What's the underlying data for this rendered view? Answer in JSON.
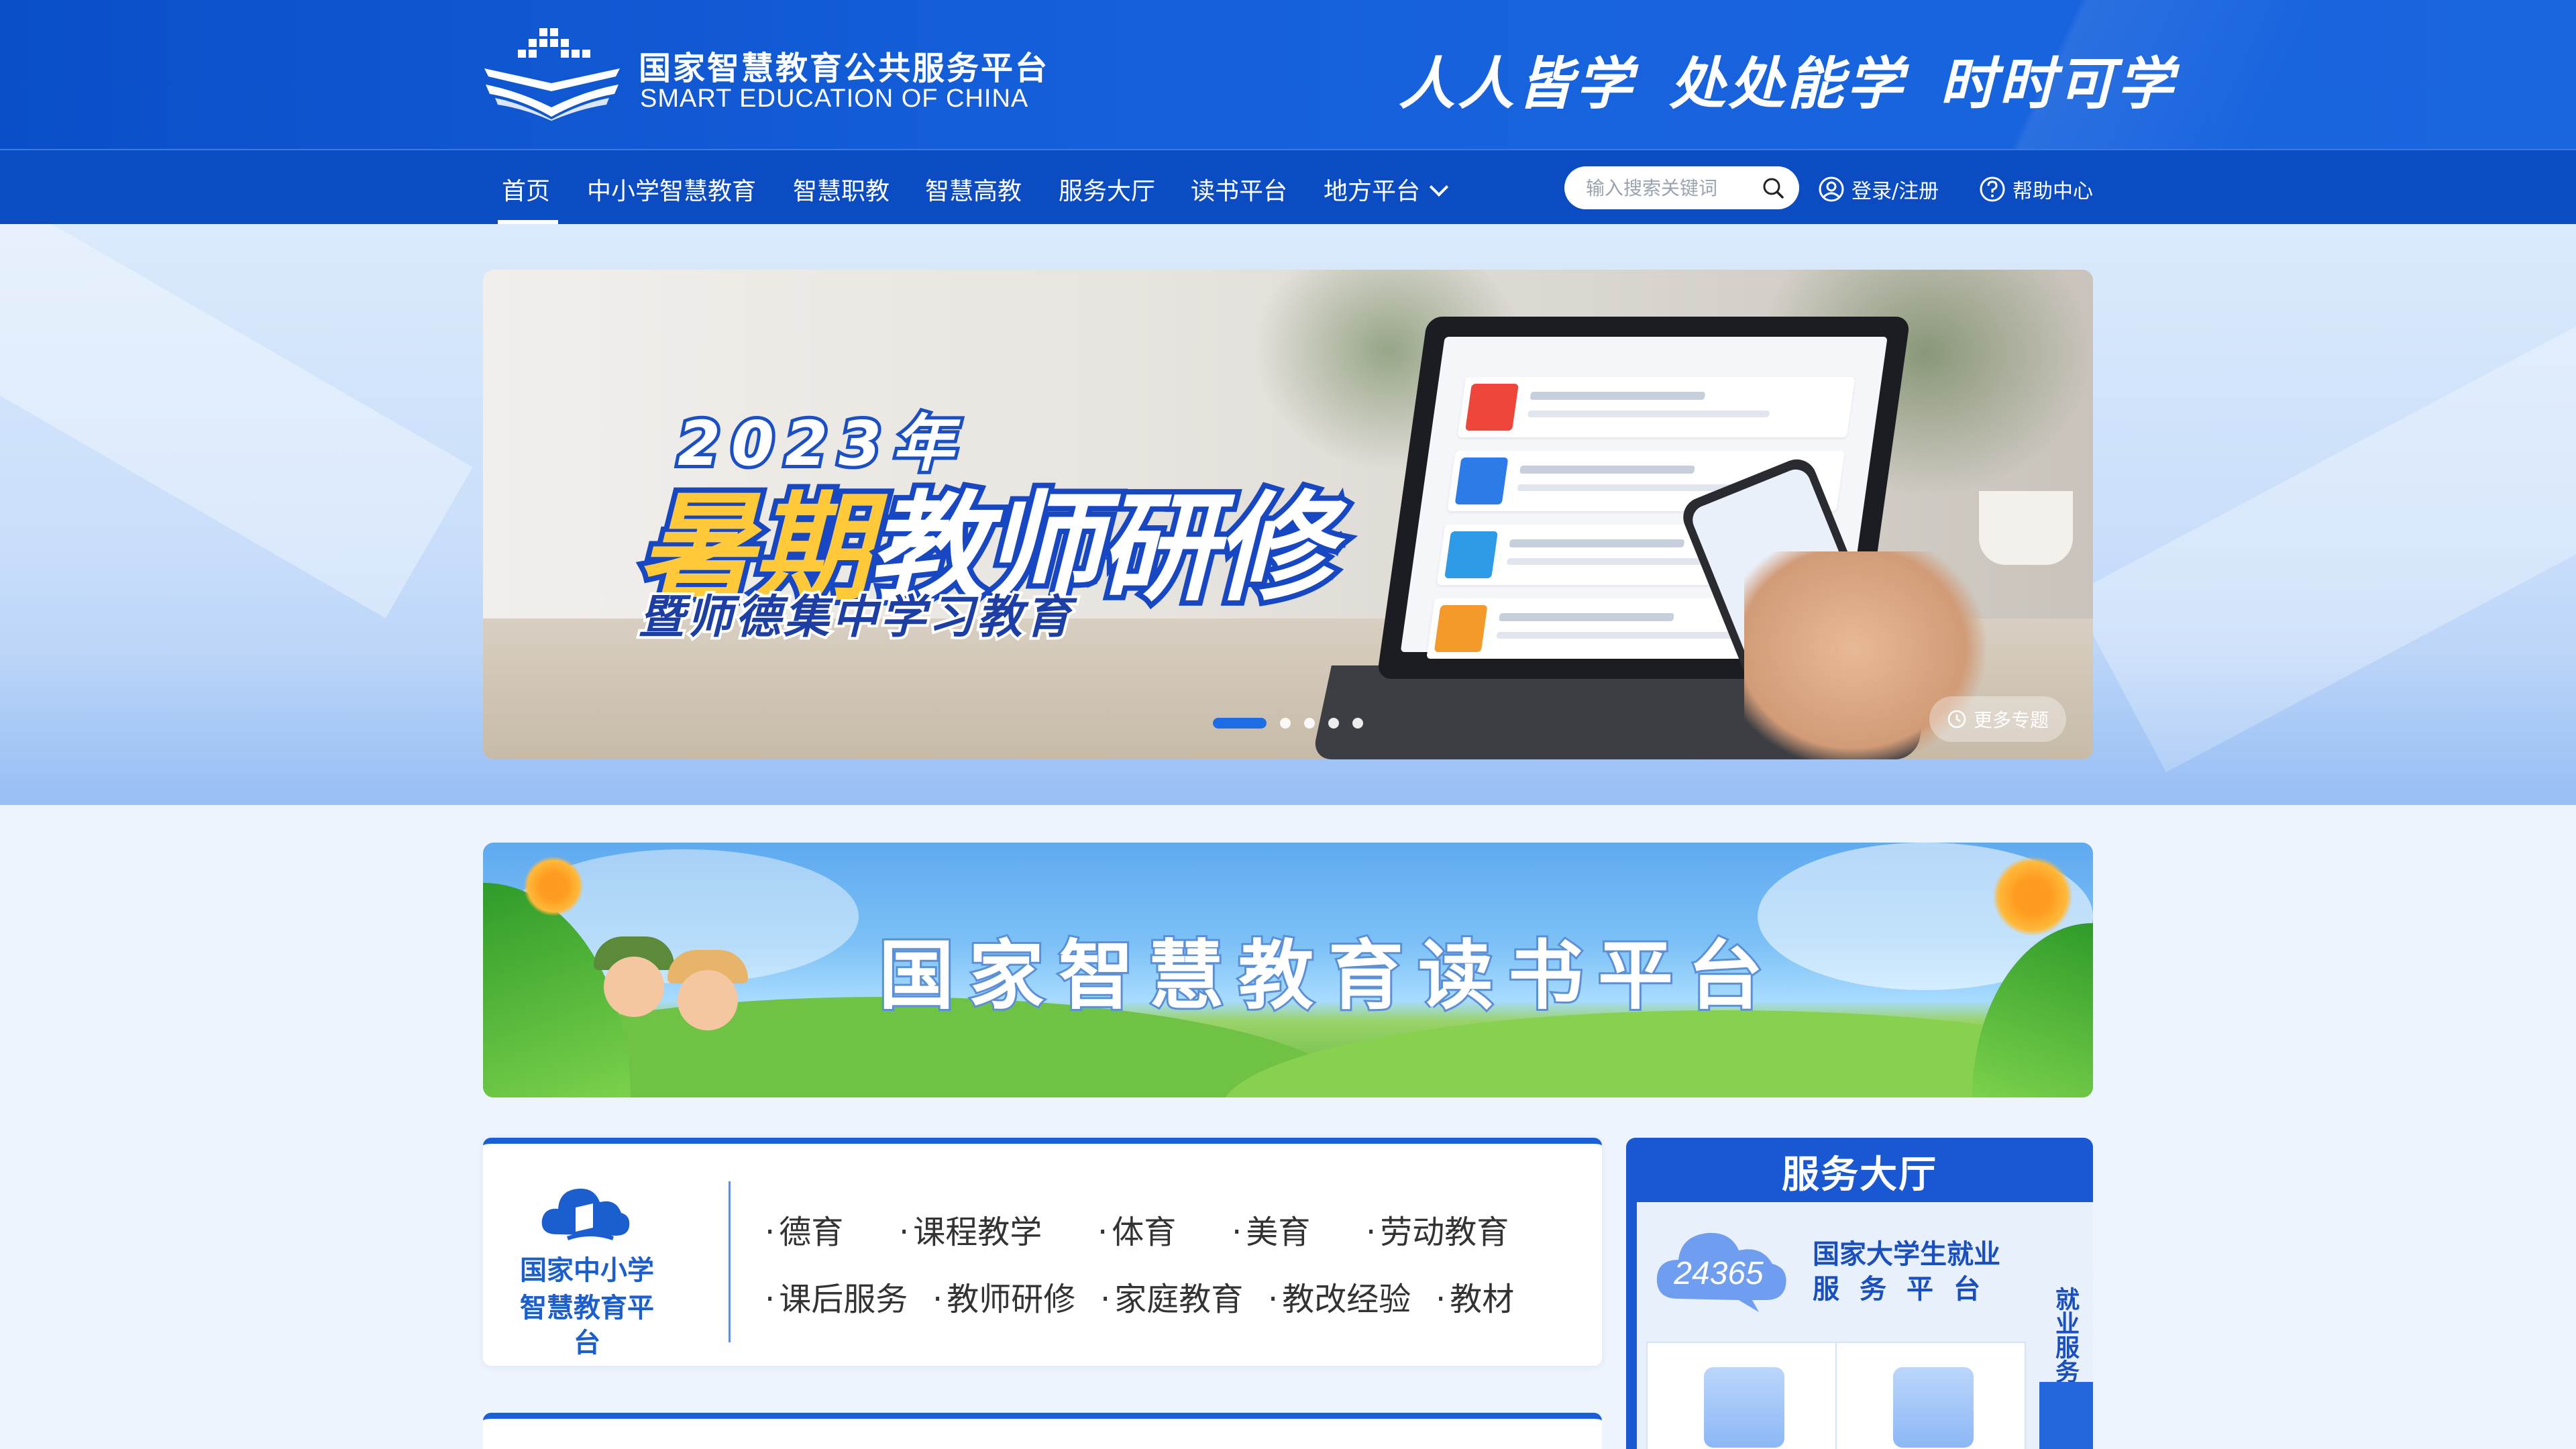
{
  "header": {
    "logo_cn": "国家智慧教育公共服务平台",
    "logo_en": "SMART EDUCATION OF CHINA",
    "slogan": "人人皆学 处处能学 时时可学"
  },
  "nav": {
    "items": [
      "首页",
      "中小学智慧教育",
      "智慧职教",
      "智慧高教",
      "服务大厅",
      "读书平台",
      "地方平台"
    ],
    "active": "首页",
    "search_placeholder": "输入搜索关键词",
    "login_label": "登录/注册",
    "help_label": "帮助中心"
  },
  "hero": {
    "year": "2023年",
    "title_gold": "暑期",
    "title_white": "教师研修",
    "subtitle": "暨师德集中学习教育",
    "more_label": "更多专题",
    "slide_count": 5,
    "active_slide": 1
  },
  "reading": {
    "title": "国家智慧教育读书平台"
  },
  "k12": {
    "logo_line1": "国家中小学",
    "logo_line2": "智慧教育平台",
    "links": [
      "德育",
      "课程教学",
      "体育",
      "美育",
      "劳动教育",
      "课后服务",
      "教师研修",
      "家庭教育",
      "教改经验",
      "教材"
    ]
  },
  "service": {
    "title": "服务大厅",
    "badge_number": "24365",
    "job_line1": "国家大学生就业",
    "job_line2": "服务平台",
    "side_label": "就业服务"
  },
  "colors": {
    "brand_blue": "#1a5fd6",
    "nav_blue": "#0b4cc2",
    "gold": "#ffc93a"
  }
}
